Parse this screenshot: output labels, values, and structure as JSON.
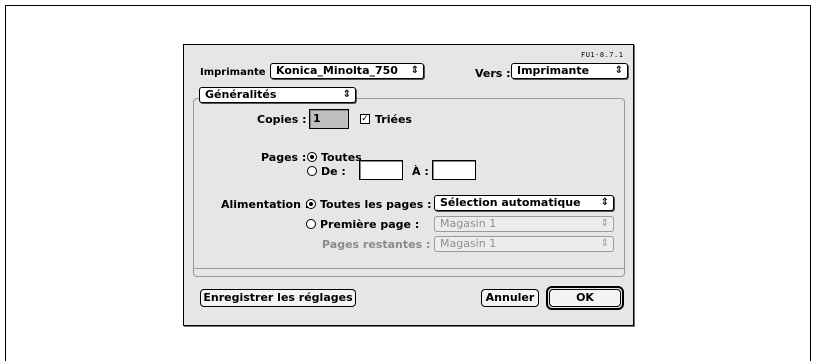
{
  "dialog": {
    "version": "FU1-8.7.1",
    "printer_label": "Imprimante :",
    "printer_value": "Konica_Minolta_750",
    "dest_label": "Vers :",
    "dest_value": "Imprimante",
    "section_value": "Généralités",
    "arrows": "⇕"
  },
  "copies": {
    "label": "Copies :",
    "value": "1",
    "collated_label": "Triées",
    "collated": true
  },
  "pages": {
    "label": "Pages :",
    "all_label": "Toutes",
    "from_label": "De :",
    "to_label": "À :",
    "from_value": "",
    "to_value": ""
  },
  "paper": {
    "label": "Alimentation :",
    "all_pages_label": "Toutes les pages :",
    "all_pages_value": "Sélection automatique",
    "first_page_label": "Première page :",
    "first_page_value": "Magasin 1",
    "remaining_label": "Pages restantes :",
    "remaining_value": "Magasin 1"
  },
  "buttons": {
    "save": "Enregistrer les réglages",
    "cancel": "Annuler",
    "ok": "OK"
  }
}
